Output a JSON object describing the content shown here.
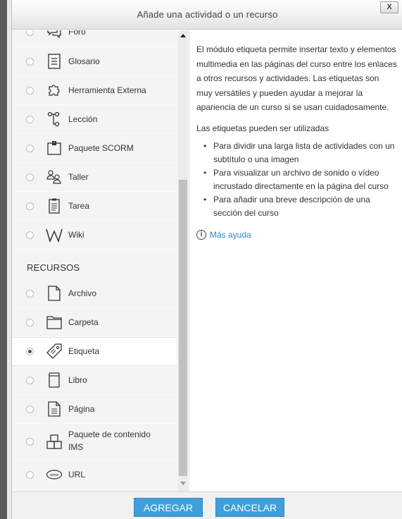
{
  "dialog": {
    "title": "Añade una actividad o un recurso",
    "close_label": "X"
  },
  "activities": [
    {
      "label": "Foro",
      "icon": "forum-icon"
    },
    {
      "label": "Glosario",
      "icon": "glossary-icon"
    },
    {
      "label": "Herramienta Externa",
      "icon": "puzzle-icon"
    },
    {
      "label": "Lección",
      "icon": "lesson-icon"
    },
    {
      "label": "Paquete SCORM",
      "icon": "scorm-icon"
    },
    {
      "label": "Taller",
      "icon": "workshop-icon"
    },
    {
      "label": "Tarea",
      "icon": "assignment-icon"
    },
    {
      "label": "Wiki",
      "icon": "wiki-icon"
    }
  ],
  "resources_heading": "RECURSOS",
  "resources": [
    {
      "label": "Archivo",
      "icon": "file-icon"
    },
    {
      "label": "Carpeta",
      "icon": "folder-icon"
    },
    {
      "label": "Etiqueta",
      "icon": "label-tag-icon",
      "selected": true
    },
    {
      "label": "Libro",
      "icon": "book-icon"
    },
    {
      "label": "Página",
      "icon": "page-icon"
    },
    {
      "label_line1": "Paquete de contenido",
      "label_line2": "IMS",
      "icon": "ims-package-icon"
    },
    {
      "label": "URL",
      "icon": "url-icon"
    }
  ],
  "description": {
    "paragraph1": "El módulo etiqueta permite insertar texto y elementos multimedia en las páginas del curso entre los enlaces a otros recursos y actividades. Las etiquetas son muy versátiles y pueden ayudar a mejorar la apariencia de un curso si se usan cuidadosamente.",
    "paragraph2": "Las etiquetas pueden ser utilizadas",
    "bullets": [
      "Para dividir una larga lista de actividades con un subtítulo o una imagen",
      "Para visualizar un archivo de sonido o vídeo incrustado directamente en la página del curso",
      "Para añadir una breve descripción de una sección del curso"
    ],
    "help_link": "Más ayuda"
  },
  "footer": {
    "add_label": "AGREGAR",
    "cancel_label": "CANCELAR"
  },
  "colors": {
    "button": "#3e9fda",
    "link": "#2b8bc6",
    "list_bg": "#f4f4f4"
  }
}
